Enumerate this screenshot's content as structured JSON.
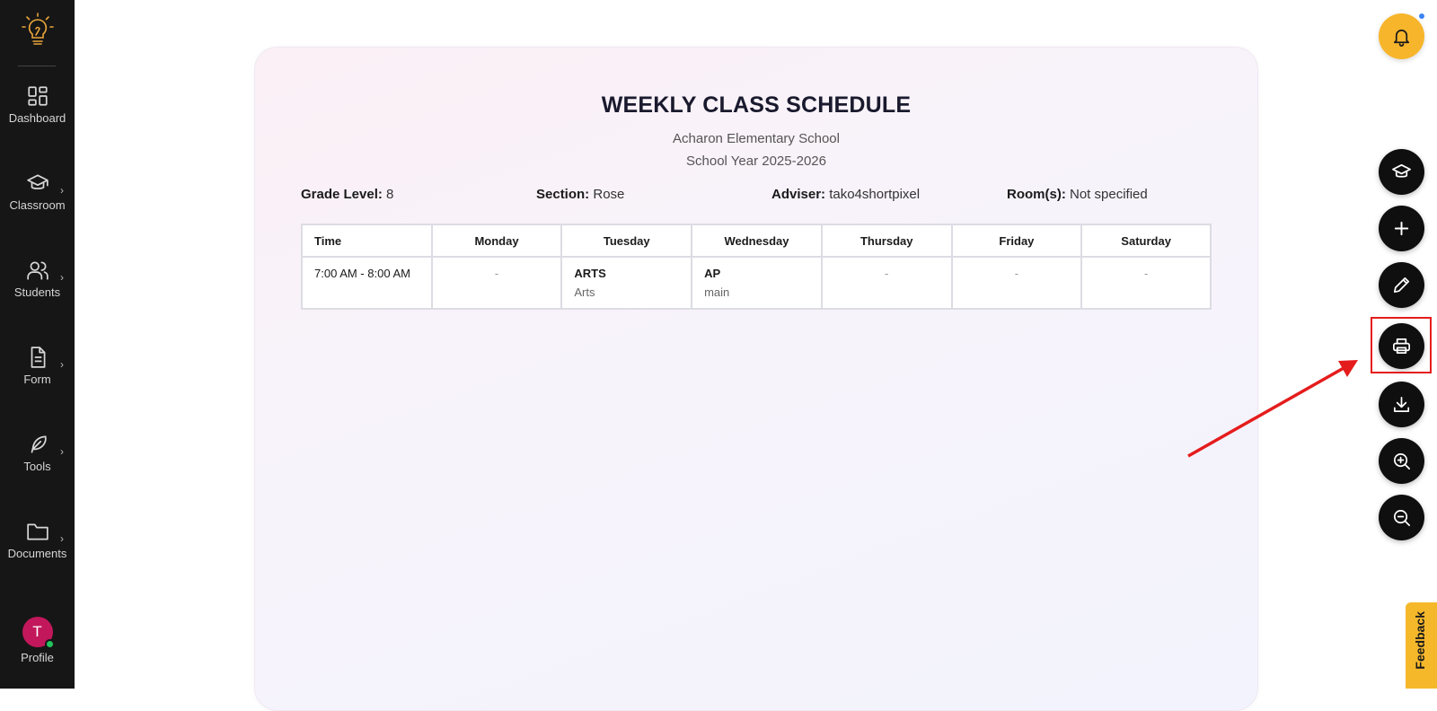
{
  "sidebar": {
    "items": [
      {
        "label": "Dashboard",
        "icon": "dashboard-grid-icon"
      },
      {
        "label": "Classroom",
        "icon": "graduation-cap-icon"
      },
      {
        "label": "Students",
        "icon": "users-icon"
      },
      {
        "label": "Form",
        "icon": "document-icon"
      },
      {
        "label": "Tools",
        "icon": "feather-icon"
      },
      {
        "label": "Documents",
        "icon": "folder-icon"
      }
    ],
    "profile": {
      "label": "Profile",
      "initial": "T"
    }
  },
  "schedule": {
    "title": "WEEKLY CLASS SCHEDULE",
    "school": "Acharon Elementary School",
    "school_year": "School Year 2025-2026",
    "grade_level_label": "Grade Level:",
    "grade_level": "8",
    "section_label": "Section:",
    "section": "Rose",
    "adviser_label": "Adviser:",
    "adviser": "tako4shortpixel",
    "rooms_label": "Room(s):",
    "rooms": "Not specified",
    "headers": [
      "Time",
      "Monday",
      "Tuesday",
      "Wednesday",
      "Thursday",
      "Friday",
      "Saturday"
    ],
    "rows": [
      {
        "time": "7:00 AM - 8:00 AM",
        "monday": "-",
        "tuesday": {
          "subject": "ARTS",
          "detail": "Arts"
        },
        "wednesday": {
          "subject": "AP",
          "detail": "main"
        },
        "thursday": "-",
        "friday": "-",
        "saturday": "-"
      }
    ]
  },
  "actions": {
    "feedback_label": "Feedback"
  },
  "colors": {
    "sidebar_bg": "#161616",
    "bell_bg": "#f7b52b",
    "fab_bg": "#0f0f0f",
    "highlight": "#e51c1c",
    "feedback_bg": "#f5b82b"
  }
}
